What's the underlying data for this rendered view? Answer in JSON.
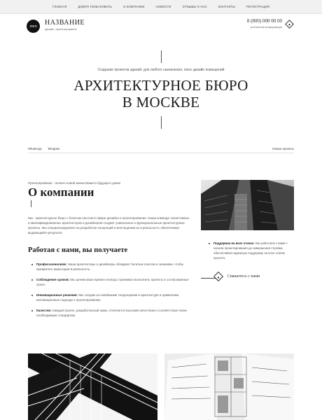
{
  "nav": {
    "items": [
      "Главная",
      "Добро пожаловать",
      "О компании",
      "Новости",
      "Отзывы о нас",
      "Контакты",
      "Регистрация"
    ]
  },
  "header": {
    "logo_text": "лого",
    "brand_name": "НАЗВАНИЕ",
    "brand_sub": "Дизайн, проектирование",
    "phone": "8 (800) 000 00 00",
    "contact_info": "контактная информация"
  },
  "hero": {
    "subtitle": "Создание проектов зданий: для любого назначения, плюс дизайн помещений",
    "title_line1": "АРХИТЕКТУРНОЕ БЮРО",
    "title_line2": "В МОСКВЕ"
  },
  "social": {
    "whatsapp": "WhatsApp",
    "telegram": "Telegram",
    "new_projects": "Новые проекты"
  },
  "about": {
    "lead": "Проектирование - начало новой жизни Вашего будущего дома!",
    "title": "О компании",
    "text": "Мы - архитектурное бюро с богатым опытом в сфере дизайна и проектирования. Наша команда талантливых и квалифицированных архитекторов и дизайнеров создает уникальные и функциональные архитектурные проекты. Мы специализируемся на разработке концепций и воплощении их в реальность обеспечивая выдающийся результат.",
    "benefits_title": "Работая с нами, вы получаете",
    "benefits": [
      {
        "bold": "Профессионализм:",
        "text": " Наши архитекторы и дизайнеры обладают богатым опытом и знаниями, чтобы превратить ваши идеи в реальность."
      },
      {
        "bold": "Соблюдение сроков:",
        "text": " Мы ценим ваше время и всегда стремимся выполнить проекты в согласованные сроки."
      },
      {
        "bold": "Инновационные решения:",
        "text": " Мы следим за новейшими тенденциями в архитектуре и применяем инновационные подходы к проектированию."
      },
      {
        "bold": "Качество:",
        "text": " Каждый проект, разработанный нами, отличается высоким качеством и соответствует всем необходимым стандартам."
      }
    ],
    "side_note_bold": "Поддержка на всех этапах:",
    "side_note_text": " Мы работаем с вами с начала проектирования до завершения стройки, обеспечивая надежную поддержку на всех этапах проекта.",
    "contact_link": "Свяжитесь с нами"
  }
}
